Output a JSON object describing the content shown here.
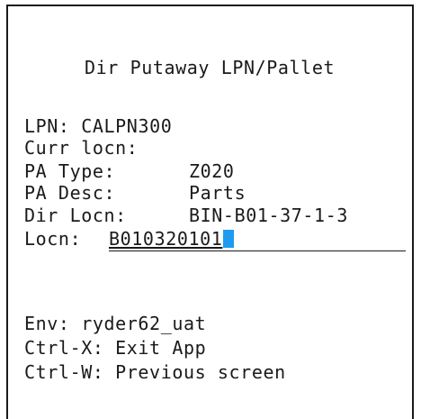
{
  "screen": {
    "title": "Dir Putaway LPN/Pallet"
  },
  "fields": {
    "lpn_label": "LPN:",
    "lpn_value": "CALPN300",
    "curr_locn_label": "Curr locn:",
    "curr_locn_value": "",
    "pa_type_label": "PA Type:",
    "pa_type_value": "Z020",
    "pa_desc_label": "PA Desc:",
    "pa_desc_value": "Parts",
    "dir_locn_label": "Dir Locn:",
    "dir_locn_value": "BIN-B01-37-1-3",
    "locn_label": "Locn:",
    "locn_value": "B010320101"
  },
  "footer": {
    "env": "Env: ryder62_uat",
    "exit": "Ctrl-X: Exit App",
    "previous": "Ctrl-W: Previous screen"
  },
  "colors": {
    "cursor": "#1e9bf0",
    "text": "#1a1a1a",
    "background": "#ffffff"
  }
}
